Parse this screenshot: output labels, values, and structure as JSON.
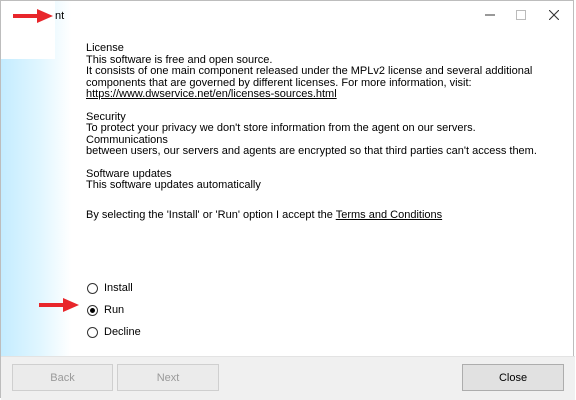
{
  "window": {
    "title": "nt"
  },
  "titlebar": {
    "minimize_icon": "minimize-icon",
    "maximize_icon": "maximize-icon",
    "close_icon": "close-icon"
  },
  "license": {
    "heading": "License",
    "lines": [
      "This software is free and open source.",
      "It consists of one main component released under the MPLv2 license and several additional",
      "components that are governed by different licenses. For more information, visit:"
    ],
    "link": "https://www.dwservice.net/en/licenses-sources.html"
  },
  "security": {
    "heading": "Security",
    "lines": [
      "To protect your privacy we don't store information from the agent on our servers. Communications",
      "between users, our servers and agents are encrypted so that third parties can't access them."
    ]
  },
  "updates": {
    "heading": "Software updates",
    "line": "This software updates automatically"
  },
  "accept": {
    "text": "By selecting the 'Install' or 'Run' option I accept the ",
    "link": "Terms and Conditions"
  },
  "options": [
    {
      "label": "Install",
      "checked": false
    },
    {
      "label": "Run",
      "checked": true
    },
    {
      "label": "Decline",
      "checked": false
    }
  ],
  "buttons": {
    "back": "Back",
    "next": "Next",
    "close": "Close"
  },
  "colors": {
    "arrow": "#e8262b",
    "sidebar_gradient": "#c4ecff",
    "footer": "#f0f0f0"
  }
}
